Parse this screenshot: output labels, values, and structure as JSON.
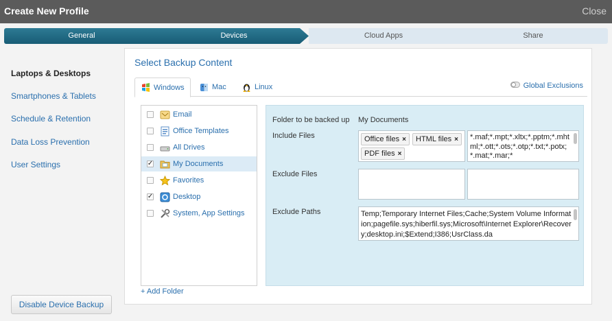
{
  "window": {
    "title": "Create New Profile",
    "close_label": "Close"
  },
  "steps": [
    {
      "label": "General",
      "state": "active"
    },
    {
      "label": "Devices",
      "state": "active"
    },
    {
      "label": "Cloud Apps",
      "state": "inactive"
    },
    {
      "label": "Share",
      "state": "inactive"
    }
  ],
  "sidebar": {
    "items": [
      {
        "label": "Laptops & Desktops",
        "active": true
      },
      {
        "label": "Smartphones & Tablets"
      },
      {
        "label": "Schedule & Retention"
      },
      {
        "label": "Data Loss Prevention"
      },
      {
        "label": "User Settings"
      }
    ],
    "disable_button": "Disable Device Backup"
  },
  "main": {
    "section_title": "Select Backup Content",
    "tabs": [
      {
        "label": "Windows",
        "icon": "windows-logo-icon",
        "active": true
      },
      {
        "label": "Mac",
        "icon": "mac-finder-icon"
      },
      {
        "label": "Linux",
        "icon": "linux-penguin-icon"
      }
    ],
    "global_exclusions": "Global Exclusions",
    "folders": [
      {
        "label": "Email",
        "checked": false,
        "icon": "email-icon"
      },
      {
        "label": "Office Templates",
        "checked": false,
        "icon": "document-icon"
      },
      {
        "label": "All Drives",
        "checked": false,
        "icon": "drive-icon"
      },
      {
        "label": "My Documents",
        "checked": true,
        "selected": true,
        "icon": "folder-icon"
      },
      {
        "label": "Favorites",
        "checked": false,
        "icon": "star-icon"
      },
      {
        "label": "Desktop",
        "checked": true,
        "icon": "desktop-icon"
      },
      {
        "label": "System, App Settings",
        "checked": false,
        "icon": "tools-icon"
      }
    ],
    "add_folder": "+ Add Folder",
    "details": {
      "folder_label": "Folder to be backed up",
      "folder_value": "My Documents",
      "include_label": "Include Files",
      "include_tags": [
        "Office files",
        "HTML files",
        "PDF files"
      ],
      "include_text": "*.maf;*.mpt;*.xltx;*.pptm;*.mhtml;*.ott;*.ots;*.otp;*.txt;*.potx;*.mat;*.mar;*",
      "exclude_files_label": "Exclude Files",
      "exclude_paths_label": "Exclude Paths",
      "exclude_paths_text": "Temp;Temporary Internet Files;Cache;System Volume Information;pagefile.sys;hiberfil.sys;Microsoft\\Internet Explorer\\Recovery;desktop.ini;$Extend;I386;UsrClass.da"
    }
  }
}
